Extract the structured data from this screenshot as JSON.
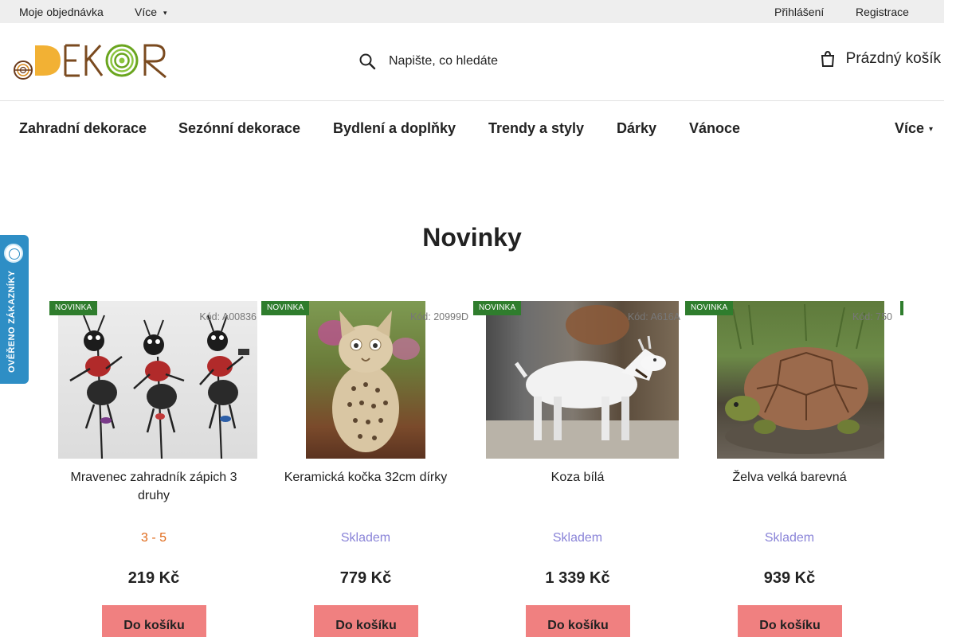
{
  "topbar": {
    "my_order": "Moje objednávka",
    "more": "Více",
    "login": "Přihlášení",
    "register": "Registrace"
  },
  "header": {
    "logo_alt": "eDEKOR",
    "search_placeholder": "Napište, co hledáte",
    "cart_label": "Prázdný košík"
  },
  "nav": {
    "items": [
      "Zahradní dekorace",
      "Sezónní dekorace",
      "Bydlení a doplňky",
      "Trendy a styly",
      "Dárky",
      "Vánoce"
    ],
    "more": "Více"
  },
  "verified_badge": {
    "text": "OVĚŘENO ZÁKAZNÍKY"
  },
  "section": {
    "title": "Novinky"
  },
  "products": [
    {
      "badge": "NOVINKA",
      "code": "Kód: A00836",
      "name": "Mravenec zahradník zápich 3 druhy",
      "availability": "3 - 5",
      "price": "219 Kč",
      "button": "Do košíku"
    },
    {
      "badge": "NOVINKA",
      "code": "Kód: 20999D",
      "name": "Keramická kočka 32cm dírky",
      "availability": "Skladem",
      "price": "779 Kč",
      "button": "Do košíku"
    },
    {
      "badge": "NOVINKA",
      "code": "Kód: A616A",
      "name": "Koza bílá",
      "availability": "Skladem",
      "price": "1 339 Kč",
      "button": "Do košíku"
    },
    {
      "badge": "NOVINKA",
      "code": "Kód: 750",
      "name": "Želva velká barevná",
      "availability": "Skladem",
      "price": "939 Kč",
      "button": "Do košíku"
    }
  ],
  "colors": {
    "badge_green": "#2f7d2d",
    "button_salmon": "#f08080",
    "stock_text": "#8a84d8",
    "days_text": "#e06a1a",
    "verified_blue": "#2e8ec5",
    "topbar_bg": "#eeeeee"
  }
}
